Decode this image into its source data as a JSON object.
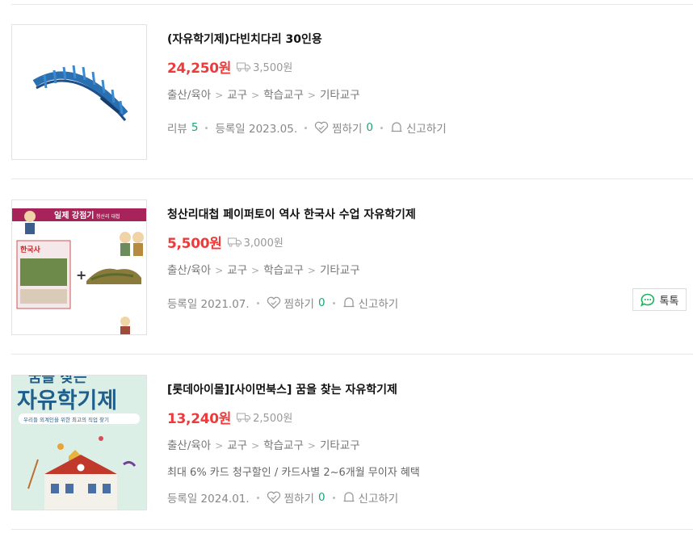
{
  "products": [
    {
      "title": "(자유학기제)다빈치다리 30인용",
      "price": "24,250원",
      "shipping": "3,500원",
      "category": [
        "출산/육아",
        "교구",
        "학습교구",
        "기타교구"
      ],
      "review_label": "리뷰",
      "review_count": "5",
      "registered": "등록일 2023.05.",
      "wish_label": "찜하기",
      "wish_count": "0",
      "report_label": "신고하기"
    },
    {
      "title": "청산리대첩 페이퍼토이 역사 한국사 수업 자유학기제",
      "price": "5,500원",
      "shipping": "3,000원",
      "category": [
        "출산/육아",
        "교구",
        "학습교구",
        "기타교구"
      ],
      "registered": "등록일 2021.07.",
      "wish_label": "찜하기",
      "wish_count": "0",
      "report_label": "신고하기",
      "talk_label": "톡톡",
      "thumb": {
        "banner": "일제 강점기",
        "banner_sub": "청산리 대첩",
        "book": "한국사"
      }
    },
    {
      "title": "[롯데아이몰][사이먼북스] 꿈을 찾는 자유학기제",
      "price": "13,240원",
      "shipping": "2,500원",
      "category": [
        "출산/육아",
        "교구",
        "학습교구",
        "기타교구"
      ],
      "promo": "최대 6% 카드 청구할인 / 카드사별 2~6개월 무이자 혜택",
      "registered": "등록일 2024.01.",
      "wish_label": "찜하기",
      "wish_count": "0",
      "report_label": "신고하기",
      "thumb": {
        "cover_top": "꿈을 찾는",
        "cover_title": "자유학기제",
        "cover_sub": "우리들 외계인을 위한 최고의 직업 찾기"
      }
    }
  ],
  "colors": {
    "price": "#ed3a3a",
    "count": "#1ba672",
    "meta": "#888888"
  },
  "icons": {
    "shipping": "truck-icon",
    "wish": "heart-icon",
    "report": "bell-icon",
    "talk": "chat-bubble-icon"
  }
}
